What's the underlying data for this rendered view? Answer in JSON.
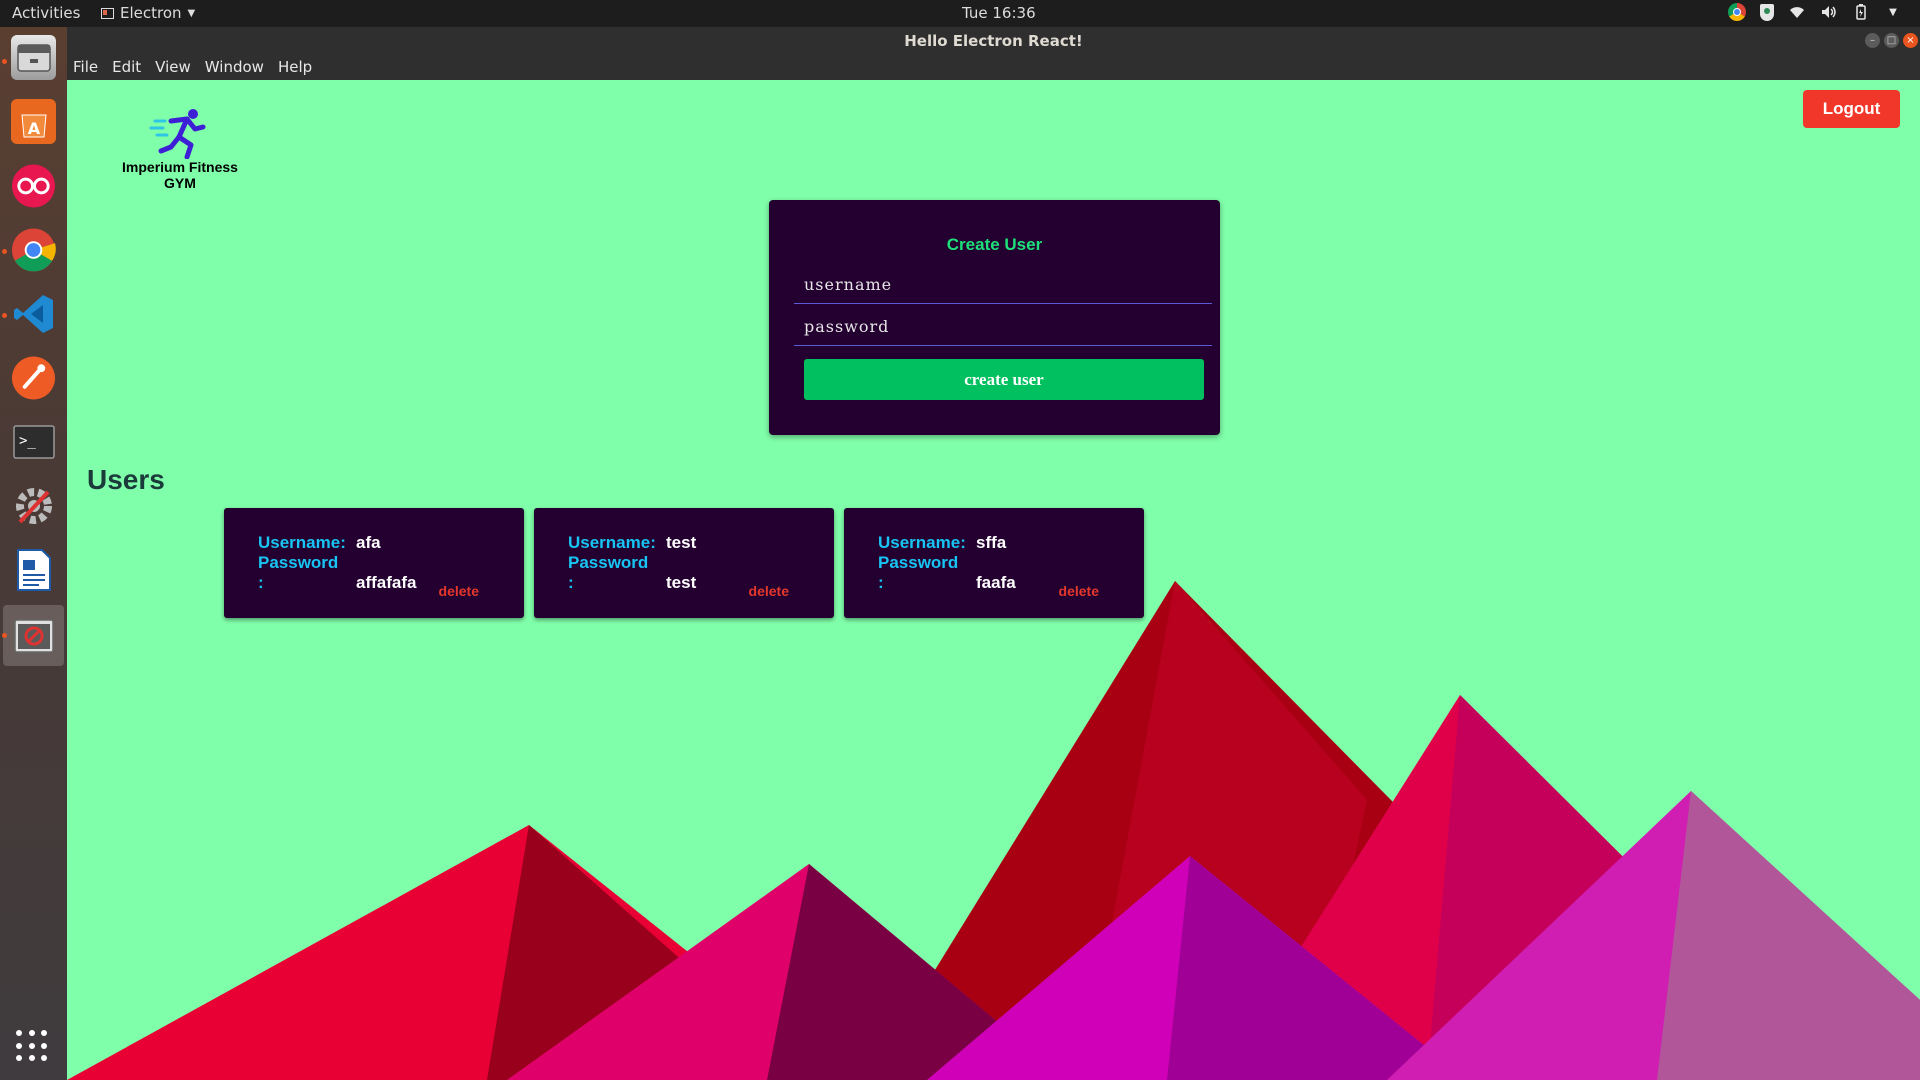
{
  "topbar": {
    "activities": "Activities",
    "app_name": "Electron",
    "clock": "Tue 16:36"
  },
  "window": {
    "title": "Hello Electron React!"
  },
  "menu": [
    "File",
    "Edit",
    "View",
    "Window",
    "Help"
  ],
  "dock": {
    "apps": [
      "files",
      "software-center",
      "flickr",
      "chrome",
      "vscode",
      "postman",
      "terminal",
      "system-tools",
      "writer",
      "electron-app"
    ]
  },
  "app": {
    "brand": "Imperium Fitness GYM",
    "logout_label": "Logout",
    "create_user": {
      "title": "Create User",
      "username_placeholder": "username",
      "password_placeholder": "password",
      "button_label": "create user"
    },
    "users_heading": "Users",
    "labels": {
      "username": "Username:",
      "password": "Password :",
      "delete": "delete"
    },
    "users": [
      {
        "username": "afa",
        "password": "affafafa"
      },
      {
        "username": "test",
        "password": "test"
      },
      {
        "username": "sffa",
        "password": "faafa"
      }
    ]
  },
  "colors": {
    "background": "#80ffaa",
    "panel": "#230030",
    "accent_green": "#00c060",
    "logout_red": "#f0372a",
    "label_cyan": "#17c4f2",
    "delete_red": "#e2382b"
  }
}
